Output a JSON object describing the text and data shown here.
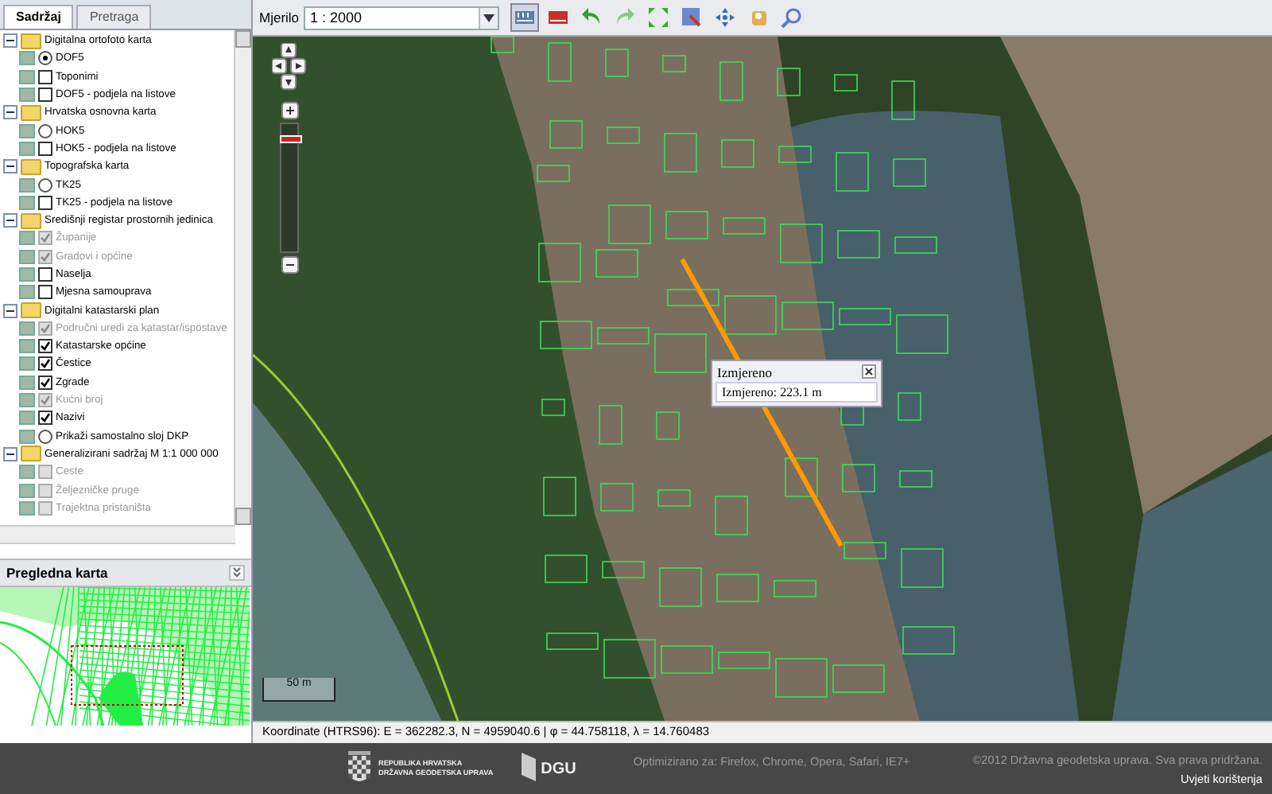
{
  "panel": {
    "tabs": [
      {
        "label": "Sadržaj",
        "selected": true
      },
      {
        "label": "Pretraga",
        "selected": false
      }
    ],
    "layers": [
      {
        "label": "Digitalna ortofoto karta",
        "expanded": true,
        "children": [
          {
            "label": "DOF5",
            "kind": "radio",
            "checked": true,
            "disabled": false
          },
          {
            "label": "Toponimi",
            "kind": "checkbox",
            "checked": false,
            "disabled": false
          },
          {
            "label": "DOF5 - podjela na listove",
            "kind": "checkbox",
            "checked": false,
            "disabled": false
          }
        ]
      },
      {
        "label": "Hrvatska osnovna karta",
        "expanded": true,
        "children": [
          {
            "label": "HOK5",
            "kind": "radio",
            "checked": false,
            "disabled": false
          },
          {
            "label": "HOK5 - podjela na listove",
            "kind": "checkbox",
            "checked": false,
            "disabled": false
          }
        ]
      },
      {
        "label": "Topografska karta",
        "expanded": true,
        "children": [
          {
            "label": "TK25",
            "kind": "radio",
            "checked": false,
            "disabled": false
          },
          {
            "label": "TK25 - podjela na listove",
            "kind": "checkbox",
            "checked": false,
            "disabled": false
          }
        ]
      },
      {
        "label": "Središnji registar prostornih jedinica",
        "expanded": true,
        "children": [
          {
            "label": "Županije",
            "kind": "checkbox",
            "checked": true,
            "disabled": true
          },
          {
            "label": "Gradovi i općine",
            "kind": "checkbox",
            "checked": true,
            "disabled": true
          },
          {
            "label": "Naselja",
            "kind": "checkbox",
            "checked": false,
            "disabled": false
          },
          {
            "label": "Mjesna samouprava",
            "kind": "checkbox",
            "checked": false,
            "disabled": false
          }
        ]
      },
      {
        "label": "Digitalni katastarski plan",
        "expanded": true,
        "children": [
          {
            "label": "Područni uredi za katastar/ispostave",
            "kind": "checkbox",
            "checked": true,
            "disabled": true
          },
          {
            "label": "Katastarske općine",
            "kind": "checkbox",
            "checked": true,
            "disabled": false
          },
          {
            "label": "Čestice",
            "kind": "checkbox",
            "checked": true,
            "disabled": false
          },
          {
            "label": "Zgrade",
            "kind": "checkbox",
            "checked": true,
            "disabled": false
          },
          {
            "label": "Kućni broj",
            "kind": "checkbox",
            "checked": true,
            "disabled": true
          },
          {
            "label": "Nazivi",
            "kind": "checkbox",
            "checked": true,
            "disabled": false
          },
          {
            "label": "Prikaži samostalno sloj DKP",
            "kind": "radio",
            "checked": false,
            "disabled": false
          }
        ]
      },
      {
        "label": "Generalizirani sadržaj M 1:1 000 000",
        "expanded": true,
        "children": [
          {
            "label": "Ceste",
            "kind": "checkbox",
            "checked": false,
            "disabled": true
          },
          {
            "label": "Željezničke pruge",
            "kind": "checkbox",
            "checked": false,
            "disabled": true
          },
          {
            "label": "Trajektna pristaništa",
            "kind": "checkbox",
            "checked": false,
            "disabled": true
          }
        ]
      }
    ],
    "overview": {
      "title": "Pregledna karta"
    }
  },
  "toolbar": {
    "scale_label": "Mjerilo",
    "scale_value": "1 : 2000"
  },
  "map": {
    "zoom_slider": {
      "level": 0.9
    },
    "popup": {
      "title": "Izmjereno",
      "text": "Izmjereno: 223.1 m"
    },
    "scale_bar": "50 m"
  },
  "status_bar": {
    "coordinates": "Koordinate (HTRS96): E = 362282.3, N = 4959040.6 | φ = 44.758118, λ = 14.760483"
  },
  "footer": {
    "logo_lines": [
      "REPUBLIKA HRVATSKA",
      "DRŽAVNA GEODETSKA UPRAVA"
    ],
    "dgu_logo": "DGU",
    "browsers": "Optimizirano za: Firefox, Chrome, Opera, Safari, IE7+",
    "copyright": "©2012 Državna geodetska uprava. Sva prava pridržana.",
    "terms_link": "Uvjeti korištenja"
  }
}
